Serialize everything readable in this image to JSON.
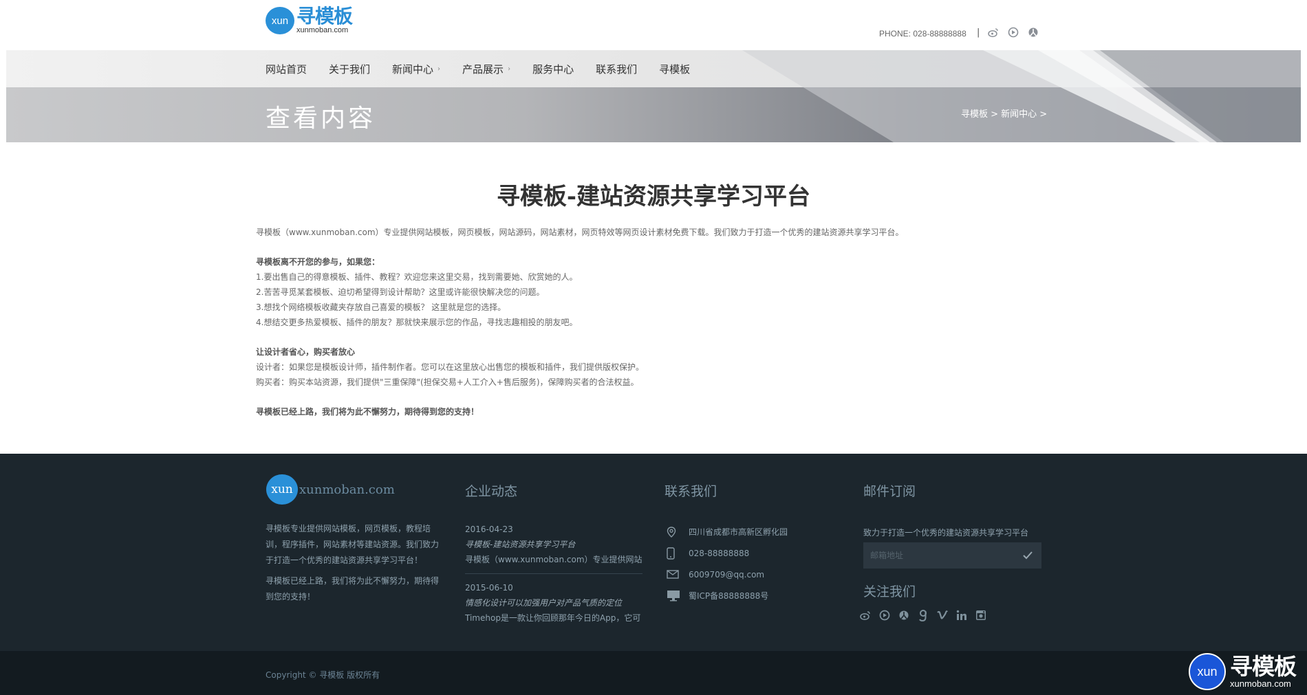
{
  "header": {
    "logo_bubble": "xun",
    "logo_cn": "寻模板",
    "logo_en": "xunmoban.com",
    "phone": "PHONE: 028-88888888",
    "separator": "|"
  },
  "nav": {
    "items": [
      {
        "label": "网站首页",
        "has_submenu": false
      },
      {
        "label": "关于我们",
        "has_submenu": false
      },
      {
        "label": "新闻中心",
        "has_submenu": true
      },
      {
        "label": "产品展示",
        "has_submenu": true
      },
      {
        "label": "服务中心",
        "has_submenu": false
      },
      {
        "label": "联系我们",
        "has_submenu": false
      },
      {
        "label": "寻模板",
        "has_submenu": false
      }
    ],
    "chevron": "›"
  },
  "banner": {
    "page_title": "查看内容",
    "breadcrumb": "寻模板 > 新闻中心 >"
  },
  "article": {
    "title": "寻模板-建站资源共享学习平台",
    "intro": "寻模板（www.xunmoban.com）专业提供网站模板，网页模板，网站源码，网站素材，网页特效等网页设计素材免费下载。我们致力于打造一个优秀的建站资源共享学习平台。",
    "section1_heading": "寻模板离不开您的参与，如果您：",
    "section1_items": [
      "1.要出售自己的得意模板、插件、教程？欢迎您来这里交易，找到需要她、欣赏她的人。",
      "2.苦苦寻觅某套模板、迫切希望得到设计帮助？这里或许能很快解决您的问题。",
      "3.想找个网络模板收藏夹存放自己喜爱的模板？ 这里就是您的选择。",
      "4.想结交更多热爱模板、插件的朋友？那就快来展示您的作品，寻找志趣相投的朋友吧。"
    ],
    "section2_heading": "让设计者省心，购买者放心",
    "section2_items": [
      "设计者：如果您是模板设计师，插件制作者。您可以在这里放心出售您的模板和插件，我们提供版权保护。",
      "购买者：购买本站资源，我们提供\"三重保障\"(担保交易+人工介入+售后服务)，保障购买者的合法权益。"
    ],
    "closing": "寻模板已经上路，我们将为此不懈努力，期待得到您的支持！"
  },
  "footer": {
    "logo_bubble": "xun",
    "logo_text": "xunmoban.com",
    "about_p1": "寻模板专业提供网站模板，网页模板，教程培训，程序插件，网站素材等建站资源。我们致力于打造一个优秀的建站资源共享学习平台！",
    "about_p2": "寻模板已经上路，我们将为此不懈努力，期待得到您的支持！",
    "news_heading": "企业动态",
    "news": [
      {
        "date": "2016-04-23",
        "title": "寻模板-建站资源共享学习平台",
        "desc": "寻模板（www.xunmoban.com）专业提供网站模板"
      },
      {
        "date": "2015-06-10",
        "title": "情感化设计可以加强用户对产品气质的定位",
        "desc": "Timehop是一款让你回顾那年今日的App，它可"
      }
    ],
    "contact_heading": "联系我们",
    "contact": [
      {
        "icon": "location-icon",
        "text": "四川省成都市高新区孵化园"
      },
      {
        "icon": "phone-icon",
        "text": "028-88888888"
      },
      {
        "icon": "mail-icon",
        "text": "6009709@qq.com"
      },
      {
        "icon": "monitor-icon",
        "text": "蜀ICP备88888888号"
      }
    ],
    "subscribe_heading": "邮件订阅",
    "subscribe_text": "致力于打造一个优秀的建站资源共享学习平台",
    "subscribe_placeholder": "邮箱地址",
    "follow_heading": "关注我们",
    "copyright": "Copyright © 寻模板 版权所有"
  },
  "watermark": {
    "bubble": "xun",
    "cn": "寻模板",
    "en": "xunmoban.com"
  }
}
